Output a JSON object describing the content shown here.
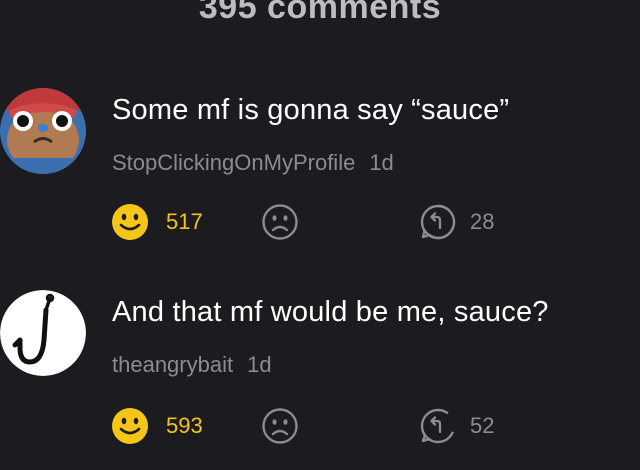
{
  "header": {
    "title": "395 comments"
  },
  "comments": [
    {
      "text": "Some mf is gonna say “sauce”",
      "username": "StopClickingOnMyProfile",
      "age": "1d",
      "likes": "517",
      "replies": "28",
      "avatar_icon": "cartoon-bear-avatar"
    },
    {
      "text": "And that mf would be me, sauce?",
      "username": "theangrybait",
      "age": "1d",
      "likes": "593",
      "replies": "52",
      "avatar_icon": "fishing-hook-avatar"
    }
  ],
  "colors": {
    "background": "#1c1b20",
    "like": "#f5c518",
    "muted": "#8b8b92",
    "header": "#bcbcc2"
  }
}
